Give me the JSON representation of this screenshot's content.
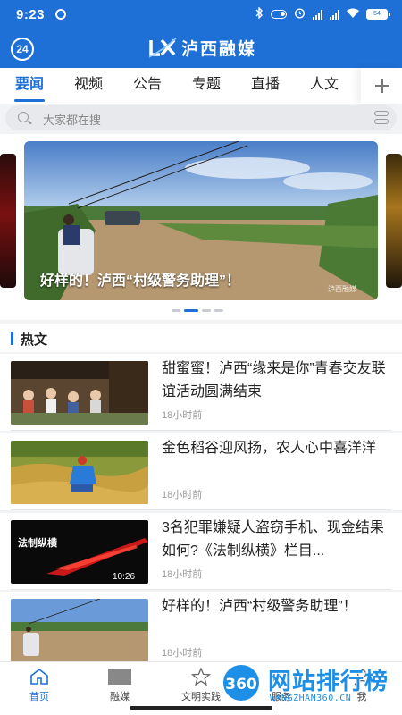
{
  "status_bar": {
    "time": "9:23",
    "battery": "54"
  },
  "header": {
    "weekly_badge": "24",
    "logo_mark": "LX",
    "app_title": "泸西融媒"
  },
  "tabs": [
    {
      "label": "要闻",
      "active": true
    },
    {
      "label": "视频"
    },
    {
      "label": "公告"
    },
    {
      "label": "专题"
    },
    {
      "label": "直播"
    },
    {
      "label": "人文"
    }
  ],
  "search": {
    "placeholder": "大家都在搜"
  },
  "carousel": {
    "caption": "好样的！泸西“村级警务助理”！",
    "watermark": "泸西融媒",
    "slide_count": 4,
    "active_index": 1
  },
  "hot": {
    "heading": "热文",
    "items": [
      {
        "title": "甜蜜蜜！泸西“缘来是你”青春交友联谊活动圆满结束",
        "time": "18小时前"
      },
      {
        "title": "金色稻谷迎风扬，农人心中喜洋洋",
        "time": "18小时前"
      },
      {
        "title": "3名犯罪嫌疑人盗窃手机、现金结果如何?《法制纵横》栏目...",
        "time": "18小时前",
        "thumb_label": "法制纵横",
        "duration": "10:26"
      },
      {
        "title": "好样的！泸西“村级警务助理”！",
        "time": "18小时前"
      }
    ]
  },
  "bottom_nav": [
    {
      "label": "首页",
      "icon": "home-icon",
      "active": true
    },
    {
      "label": "融媒",
      "icon": "media-icon"
    },
    {
      "label": "文明实践",
      "icon": "star-icon"
    },
    {
      "label": "服务",
      "icon": "service-icon"
    },
    {
      "label": "我",
      "icon": "profile-icon"
    }
  ],
  "watermark": {
    "badge": "360",
    "name": "网站排行榜",
    "url": "WANGZHAN360.CN"
  },
  "colors": {
    "brand": "#1e6fd6",
    "page_bg": "#f2f3f5"
  }
}
